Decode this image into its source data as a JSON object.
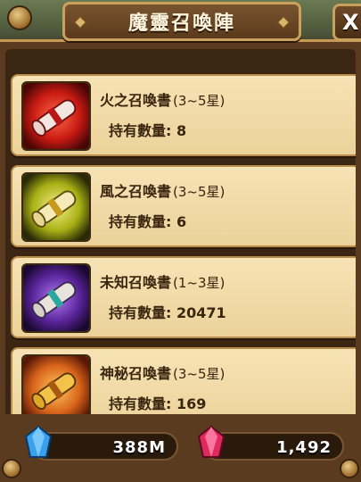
{
  "header": {
    "title": "魔靈召喚陣",
    "close_label": "X"
  },
  "scrolls": [
    {
      "name": "火之召喚書",
      "range": "(3~5星)",
      "qty_label": "持有數量:",
      "qty": "8",
      "icon": "fire-scroll-icon",
      "color": "#d8281e"
    },
    {
      "name": "風之召喚書",
      "range": "(3~5星)",
      "qty_label": "持有數量:",
      "qty": "6",
      "icon": "wind-scroll-icon",
      "color": "#b9c41a"
    },
    {
      "name": "未知召喚書",
      "range": "(1~3星)",
      "qty_label": "持有數量:",
      "qty": "20471",
      "icon": "unknown-scroll-icon",
      "color": "#6a2fa8"
    },
    {
      "name": "神秘召喚書",
      "range": "(3~5星)",
      "qty_label": "持有數量:",
      "qty": "169",
      "icon": "mystical-scroll-icon",
      "color": "#e07a14"
    }
  ],
  "currency": {
    "mana": {
      "value": "388M",
      "icon": "mana-crystal-icon",
      "color": "#2f8fd8"
    },
    "crystal": {
      "value": "1,492",
      "icon": "red-crystal-icon",
      "color": "#d8285a"
    }
  }
}
